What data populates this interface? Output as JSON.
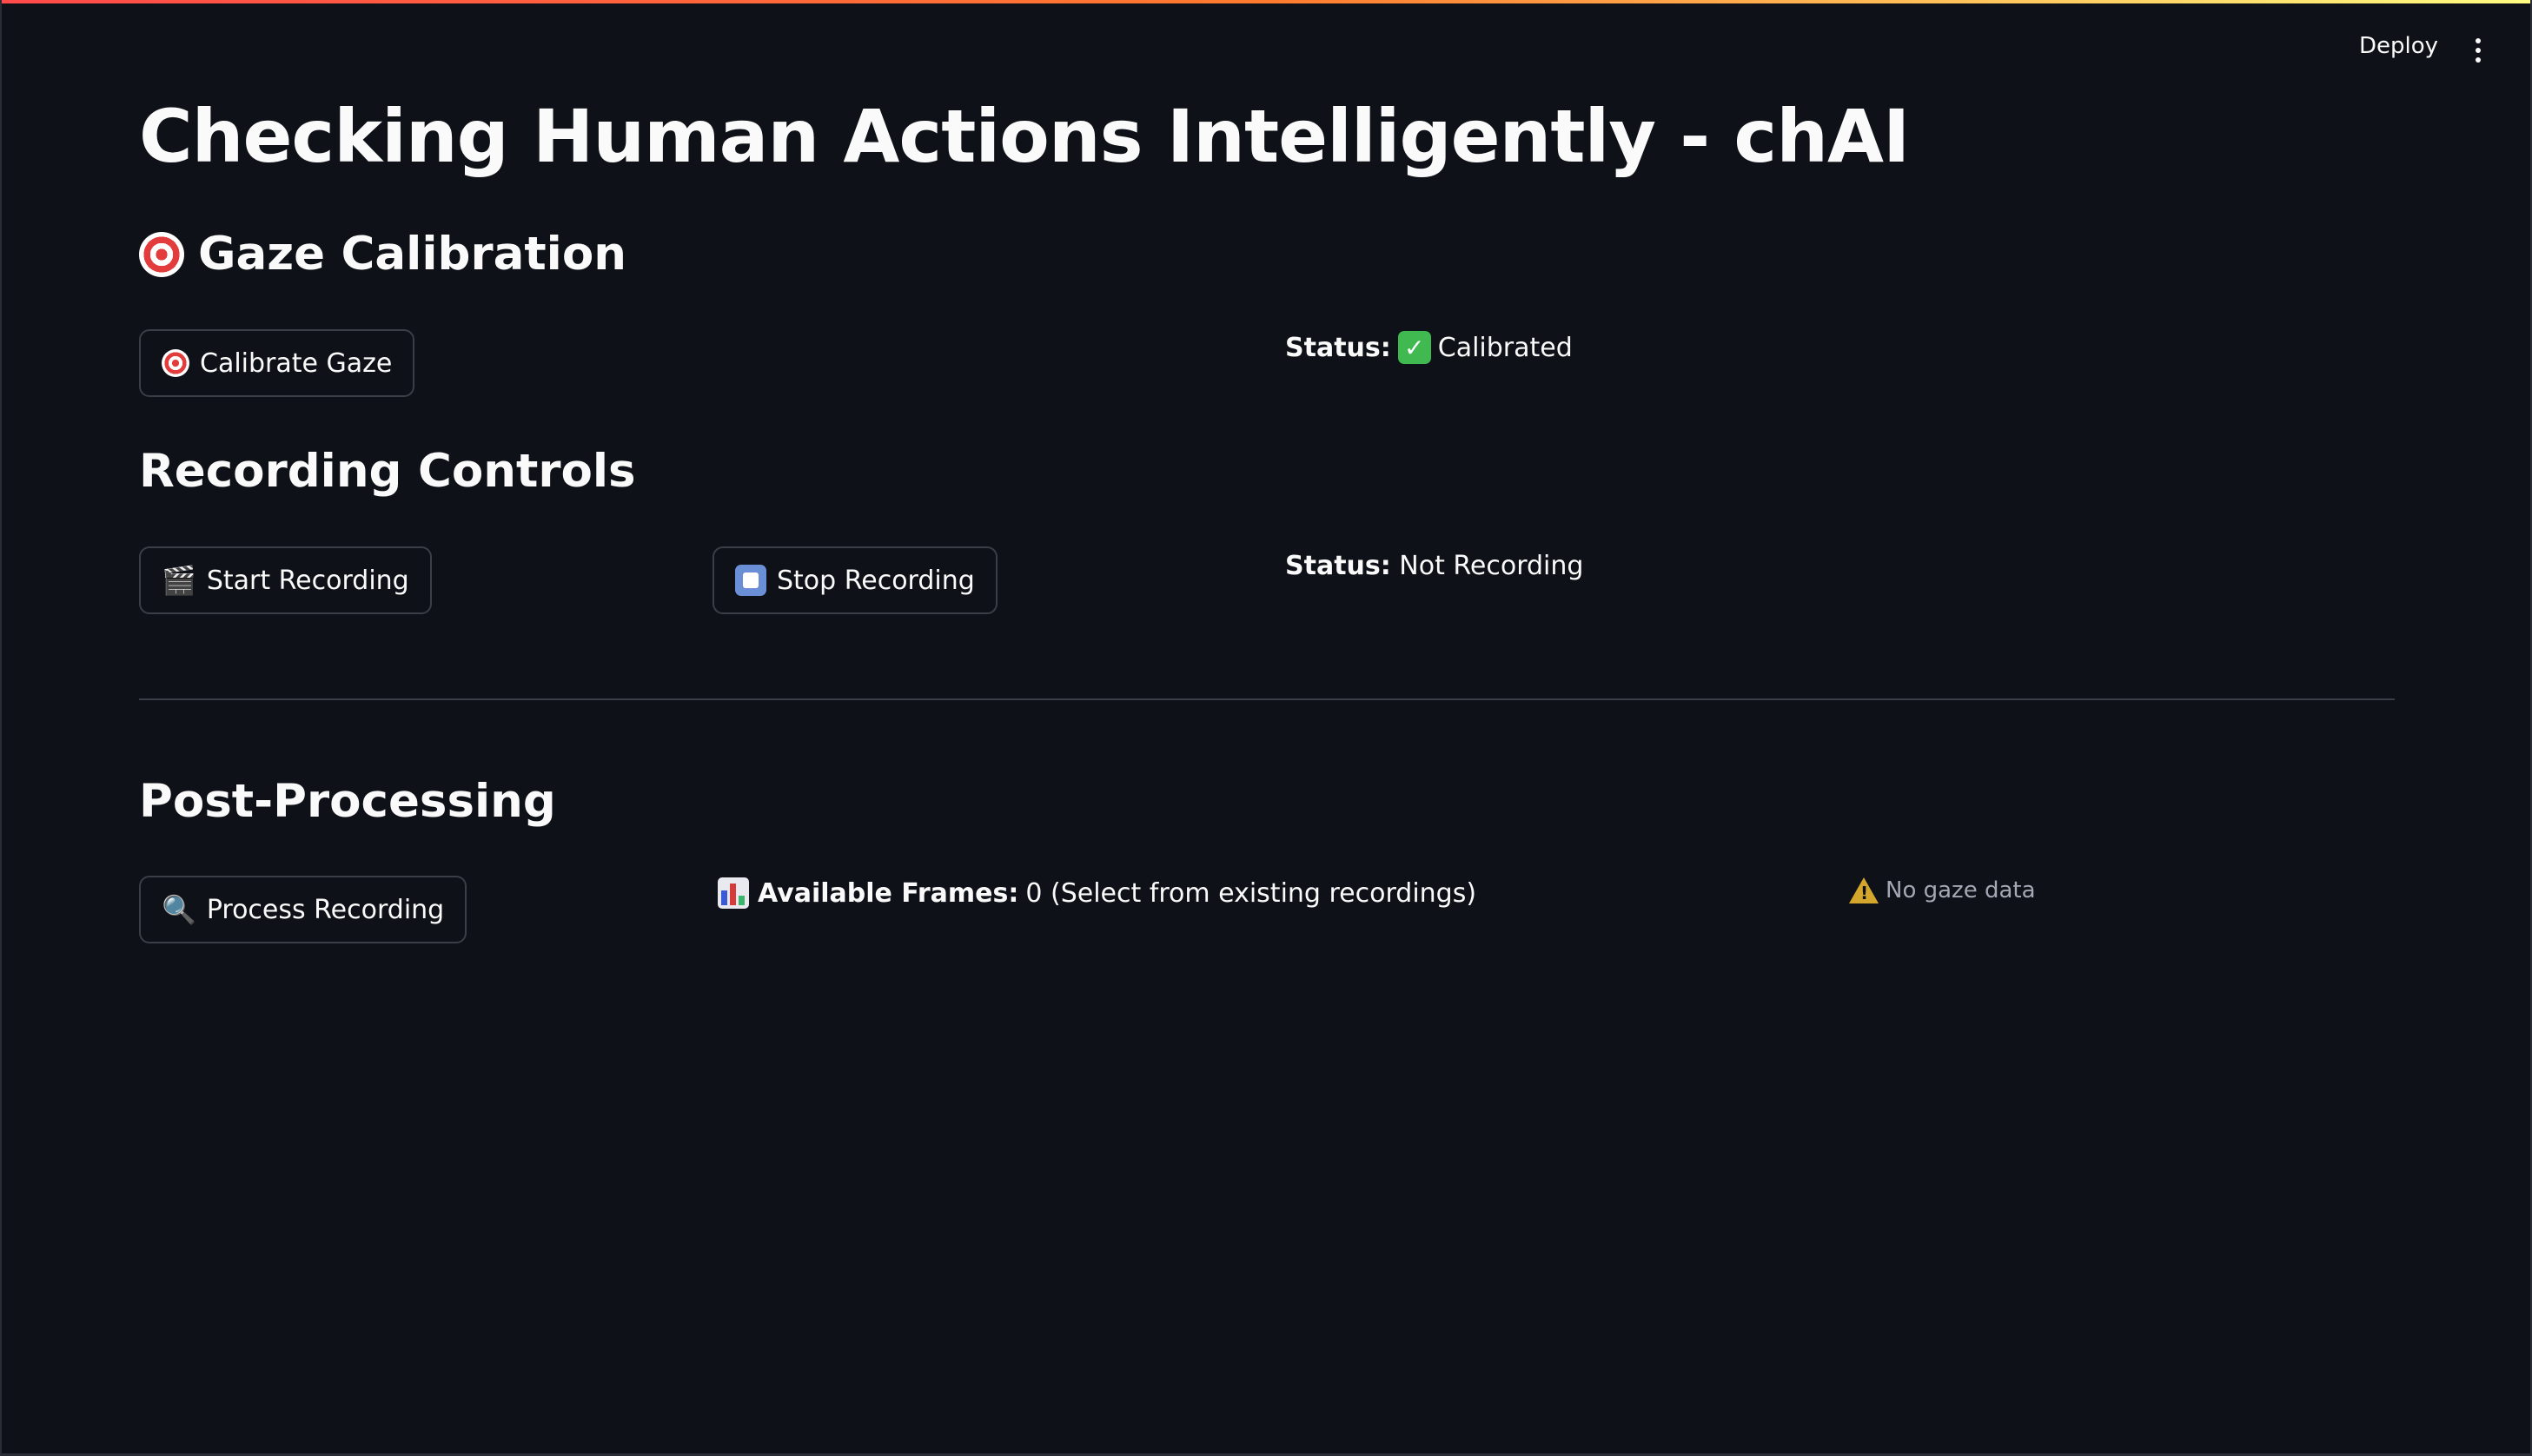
{
  "header": {
    "deploy_label": "Deploy",
    "menu_icon": "kebab-menu-icon"
  },
  "page": {
    "title": "Checking Human Actions Intelligently - chAI"
  },
  "gaze_calibration": {
    "heading": "Gaze Calibration",
    "heading_icon": "target-icon",
    "calibrate_button": "Calibrate Gaze",
    "status_label": "Status:",
    "status_value": "Calibrated",
    "status_icon": "check-icon"
  },
  "recording_controls": {
    "heading": "Recording Controls",
    "start_button": "Start Recording",
    "start_icon": "clapperboard-icon",
    "stop_button": "Stop Recording",
    "stop_icon": "stop-icon",
    "status_label": "Status:",
    "status_value": "Not Recording"
  },
  "post_processing": {
    "heading": "Post-Processing",
    "process_button": "Process Recording",
    "process_icon": "magnifier-icon",
    "frames_label": "Available Frames:",
    "frames_value": "0 (Select from existing recordings)",
    "frames_icon": "bar-chart-icon",
    "warning_text": "No gaze data",
    "warning_icon": "warning-icon"
  },
  "colors": {
    "background": "#0e1117",
    "text": "#fafafa",
    "border": "#3b3e47",
    "success": "#3fb950",
    "warning": "#d4a72c"
  }
}
